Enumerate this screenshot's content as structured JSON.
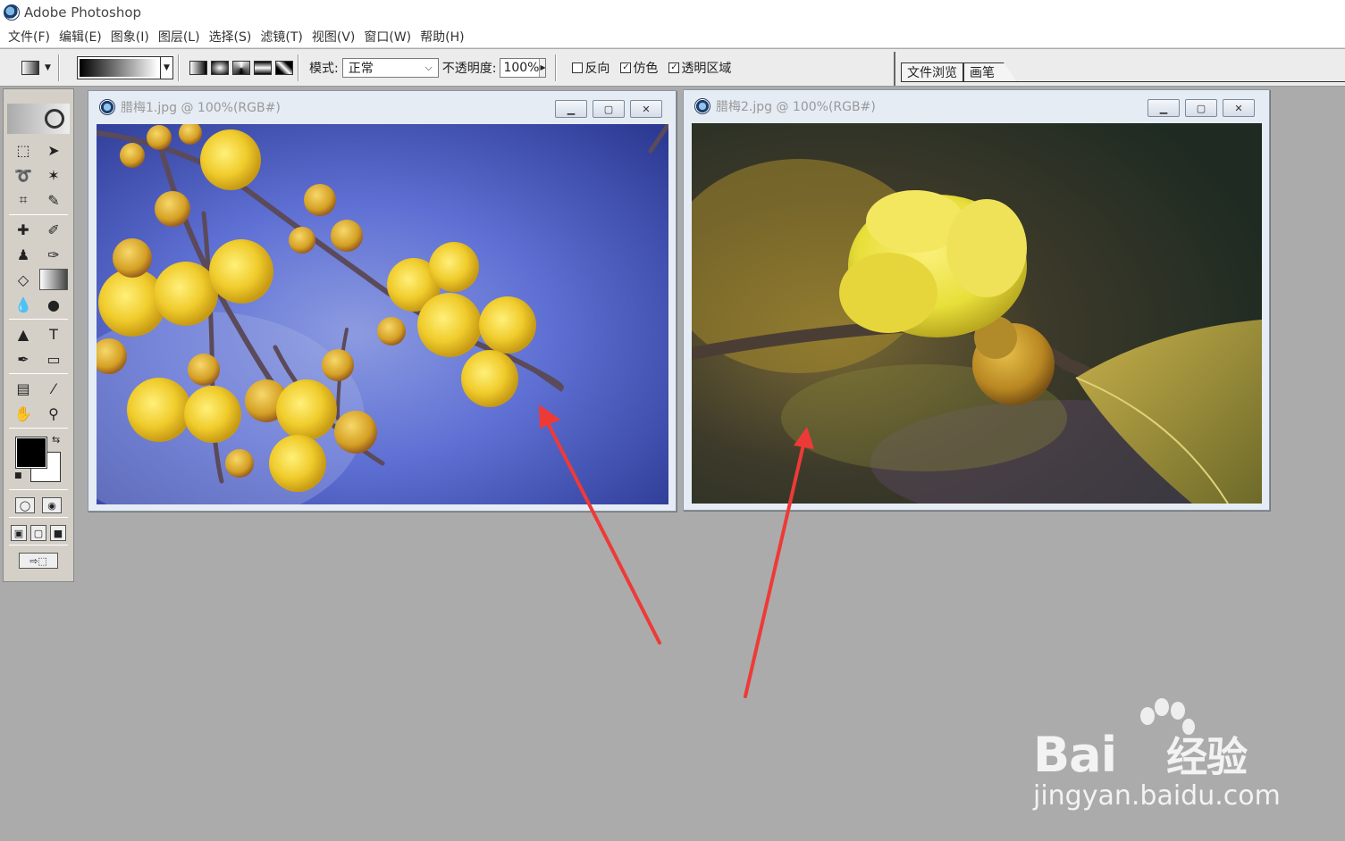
{
  "app": {
    "title": "Adobe Photoshop"
  },
  "menu": [
    "文件(F)",
    "编辑(E)",
    "图象(I)",
    "图层(L)",
    "选择(S)",
    "滤镜(T)",
    "视图(V)",
    "窗口(W)",
    "帮助(H)"
  ],
  "options": {
    "mode_label": "模式:",
    "mode_value": "正常",
    "opacity_label": "不透明度:",
    "opacity_value": "100%",
    "reverse_label": "反向",
    "reverse_checked": false,
    "dither_label": "仿色",
    "dither_checked": true,
    "transparency_label": "透明区域",
    "transparency_checked": true
  },
  "palette_well": {
    "tabs": [
      "文件浏览",
      "画笔"
    ]
  },
  "documents": [
    {
      "title": "腊梅1.jpg @ 100%(RGB#)",
      "image": "yellow-wintersweet-branch-blue-background"
    },
    {
      "title": "腊梅2.jpg @ 100%(RGB#)",
      "image": "single-yellow-wintersweet-blossom-dark-background"
    }
  ],
  "window_buttons": {
    "minimize": "minimize-icon",
    "maximize": "maximize-icon",
    "close": "close-icon"
  },
  "watermark": {
    "brand": "Bai",
    "brand_suffix": "经验",
    "url": "jingyan.baidu.com"
  },
  "colors": {
    "arrow": "#ee3a37",
    "workspace": "#ababab",
    "foreground": "#000000",
    "background": "#ffffff"
  }
}
